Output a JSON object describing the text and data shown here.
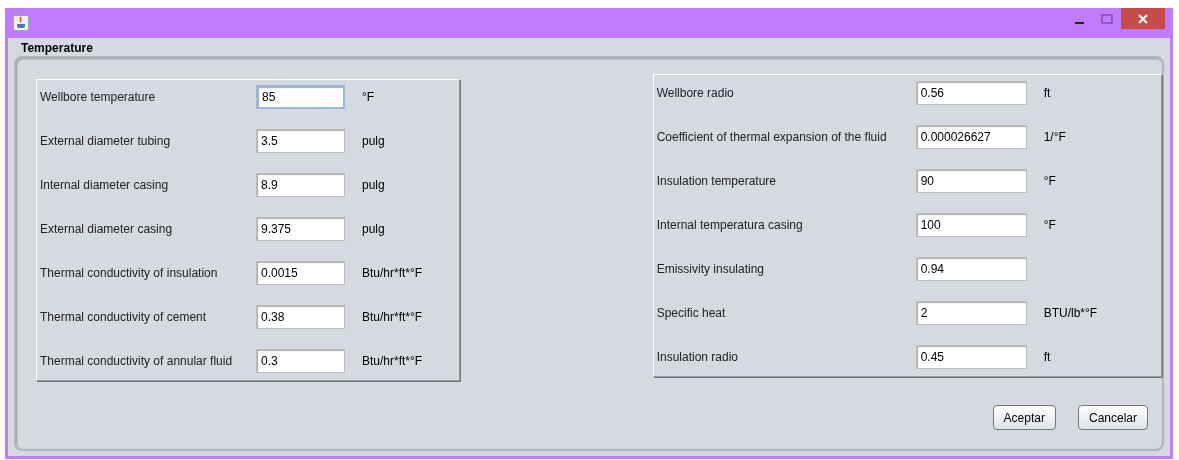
{
  "group": {
    "title": "Temperature"
  },
  "left_fields": [
    {
      "label": "Wellbore temperature",
      "value": "85",
      "unit": "°F",
      "focused": true
    },
    {
      "label": "External diameter tubing",
      "value": "3.5",
      "unit": "pulg",
      "focused": false
    },
    {
      "label": "Internal diameter casing",
      "value": "8.9",
      "unit": "pulg",
      "focused": false
    },
    {
      "label": "External diameter casing",
      "value": "9.375",
      "unit": "pulg",
      "focused": false
    },
    {
      "label": "Thermal conductivity of insulation",
      "value": "0.0015",
      "unit": "Btu/hr*ft*°F",
      "focused": false
    },
    {
      "label": "Thermal conductivity of cement",
      "value": "0.38",
      "unit": "Btu/hr*ft*°F",
      "focused": false
    },
    {
      "label": "Thermal conductivity of annular fluid",
      "value": "0.3",
      "unit": "Btu/hr*ft*°F",
      "focused": false
    }
  ],
  "right_fields": [
    {
      "label": "Wellbore radio",
      "value": "0.56",
      "unit": "ft",
      "focused": false
    },
    {
      "label": "Coefficient of thermal  expansion of the fluid",
      "value": "0.000026627",
      "unit": "1/°F",
      "focused": false
    },
    {
      "label": "Insulation temperature",
      "value": "90",
      "unit": "°F",
      "focused": false
    },
    {
      "label": "Internal temperatura casing",
      "value": "100",
      "unit": "°F",
      "focused": false
    },
    {
      "label": "Emissivity insulating",
      "value": "0.94",
      "focused": false
    },
    {
      "label": "Specific heat",
      "value": "2",
      "unit": "BTU/lb*°F",
      "focused": false
    },
    {
      "label": "Insulation radio",
      "value": "0.45",
      "unit": "ft",
      "focused": false
    }
  ],
  "buttons": [
    "Aceptar",
    "Cancelar"
  ]
}
